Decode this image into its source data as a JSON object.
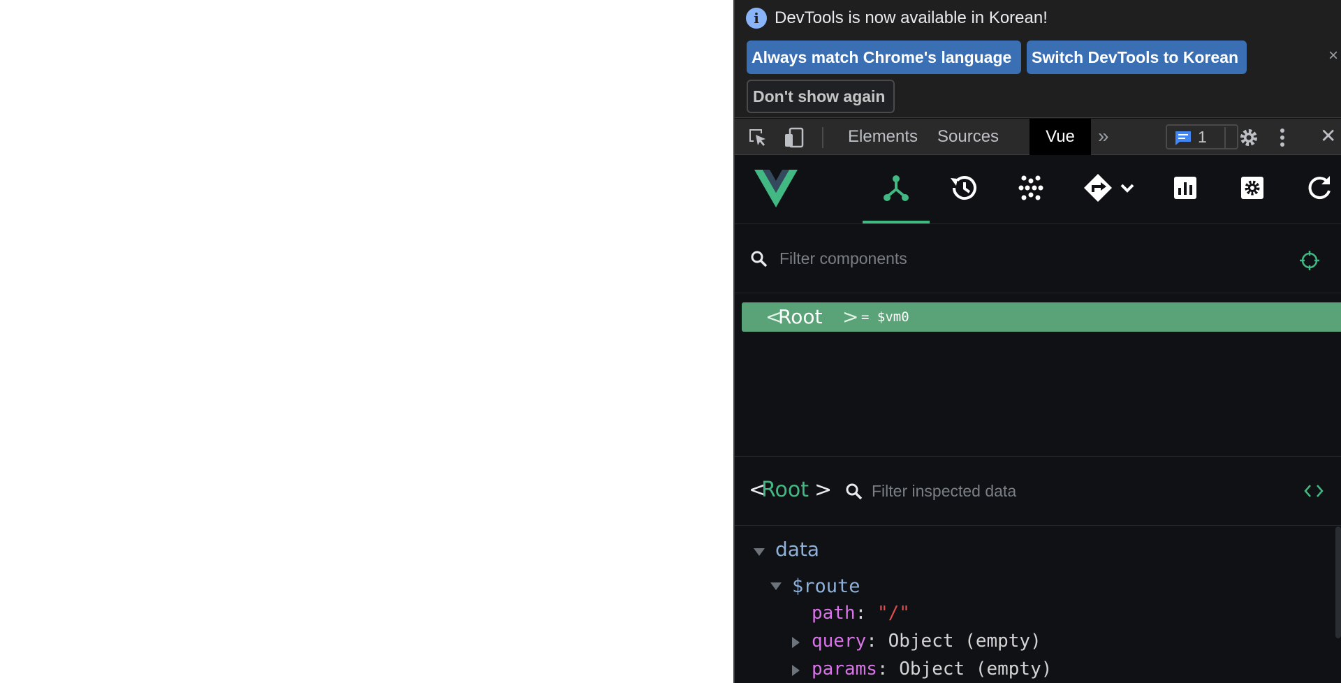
{
  "infobar": {
    "message": "DevTools is now available in Korean!",
    "match_button": "Always match Chrome's language",
    "switch_button": "Switch DevTools to Korean",
    "dont_show_button": "Don't show again",
    "close": "×"
  },
  "tabbar": {
    "tabs": [
      "Elements",
      "Sources",
      "Vue"
    ],
    "active_tab": "Vue",
    "more": "»",
    "issues_count": "1",
    "close": "✕"
  },
  "vue_toolbar": {
    "active": "components",
    "accent_color": "#42b883",
    "buttons": [
      "components-icon",
      "timeline-icon",
      "vuex-icon",
      "router-icon",
      "performance-icon",
      "settings-icon",
      "refresh-icon"
    ]
  },
  "components_filter": {
    "placeholder": "Filter components"
  },
  "component_tree": {
    "root": {
      "lt": "<",
      "name": "Root",
      "gt": ">",
      "vm": "= $vm0"
    }
  },
  "inspector": {
    "lt": "<",
    "component_name": "Root",
    "gt": ">",
    "filter_placeholder": "Filter inspected data",
    "section": "data",
    "route_key": "$route",
    "props": [
      {
        "key": "path",
        "sep": ": ",
        "value": "\"/\""
      },
      {
        "key": "query",
        "sep": ": ",
        "value": "Object (empty)"
      },
      {
        "key": "params",
        "sep": ": ",
        "value": "Object (empty)"
      }
    ]
  }
}
